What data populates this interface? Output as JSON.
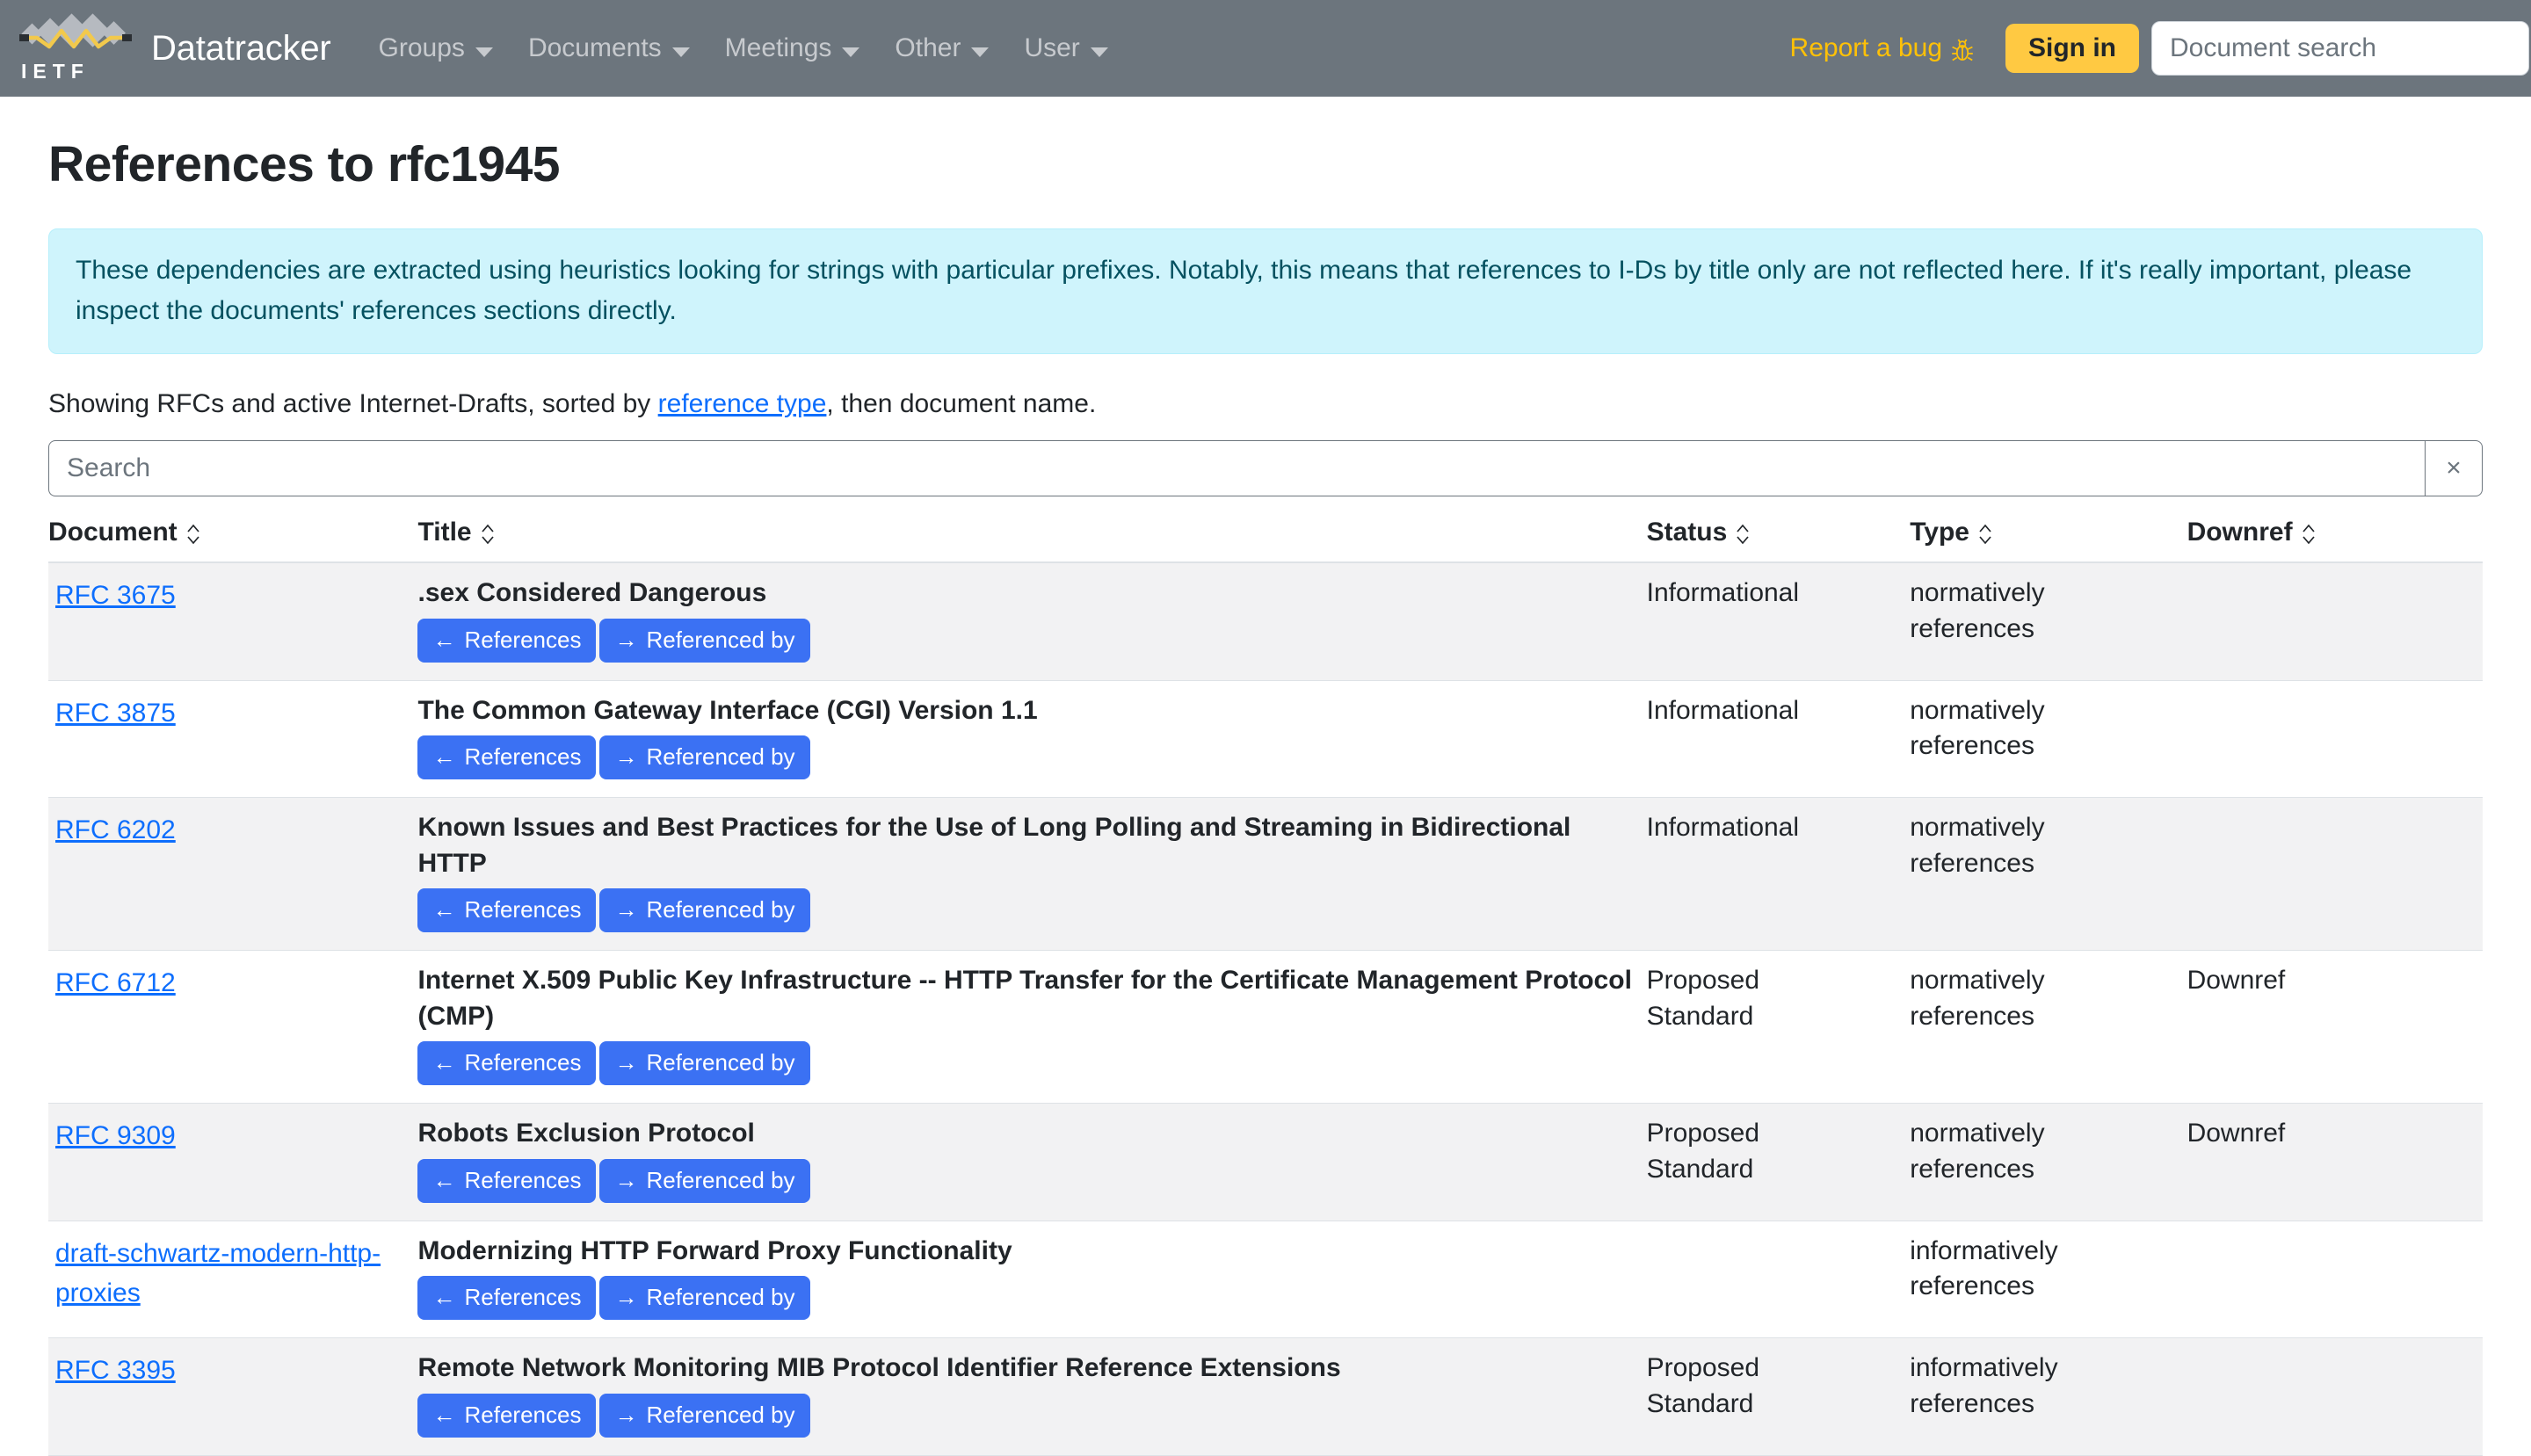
{
  "navbar": {
    "brand": "Datatracker",
    "logo_text": "I E T F",
    "menus": [
      {
        "label": "Groups"
      },
      {
        "label": "Documents"
      },
      {
        "label": "Meetings"
      },
      {
        "label": "Other"
      },
      {
        "label": "User"
      }
    ],
    "report_bug": "Report a bug",
    "sign_in": "Sign in",
    "search_placeholder": "Document search",
    "search_value": "",
    "colors": {
      "navbar_bg": "#6c757d",
      "accent_yellow": "#ffc107",
      "signin_bg": "#ffc942",
      "link_blue": "#0d6efd",
      "button_blue": "#3b71f3"
    }
  },
  "page": {
    "title": "References to rfc1945",
    "alert": "These dependencies are extracted using heuristics looking for strings with particular prefixes. Notably, this means that references to I-Ds by title only are not reflected here. If it's really important, please inspect the documents' references sections directly.",
    "showing_prefix": "Showing RFCs and active Internet-Drafts, sorted by ",
    "showing_link": "reference type",
    "showing_suffix": ", then document name."
  },
  "search": {
    "placeholder": "Search",
    "value": "",
    "clear_label": "×"
  },
  "table": {
    "headers": [
      {
        "label": "Document"
      },
      {
        "label": "Title"
      },
      {
        "label": "Status"
      },
      {
        "label": "Type"
      },
      {
        "label": "Downref"
      }
    ],
    "buttons": {
      "references": "References",
      "referenced_by": "Referenced by",
      "references_arrow": "←",
      "referenced_by_arrow": "→"
    },
    "rows": [
      {
        "document": "RFC 3675",
        "title": ".sex Considered Dangerous",
        "status": "Informational",
        "type": "normatively references",
        "downref": ""
      },
      {
        "document": "RFC 3875",
        "title": "The Common Gateway Interface (CGI) Version 1.1",
        "status": "Informational",
        "type": "normatively references",
        "downref": ""
      },
      {
        "document": "RFC 6202",
        "title": "Known Issues and Best Practices for the Use of Long Polling and Streaming in Bidirectional HTTP",
        "status": "Informational",
        "type": "normatively references",
        "downref": ""
      },
      {
        "document": "RFC 6712",
        "title": "Internet X.509 Public Key Infrastructure -- HTTP Transfer for the Certificate Management Protocol (CMP)",
        "status": "Proposed Standard",
        "type": "normatively references",
        "downref": "Downref"
      },
      {
        "document": "RFC 9309",
        "title": "Robots Exclusion Protocol",
        "status": "Proposed Standard",
        "type": "normatively references",
        "downref": "Downref"
      },
      {
        "document": "draft-schwartz-modern-http-proxies",
        "title": "Modernizing HTTP Forward Proxy Functionality",
        "status": "",
        "type": "informatively references",
        "downref": ""
      },
      {
        "document": "RFC 3395",
        "title": "Remote Network Monitoring MIB Protocol Identifier Reference Extensions",
        "status": "Proposed Standard",
        "type": "informatively references",
        "downref": ""
      }
    ]
  }
}
